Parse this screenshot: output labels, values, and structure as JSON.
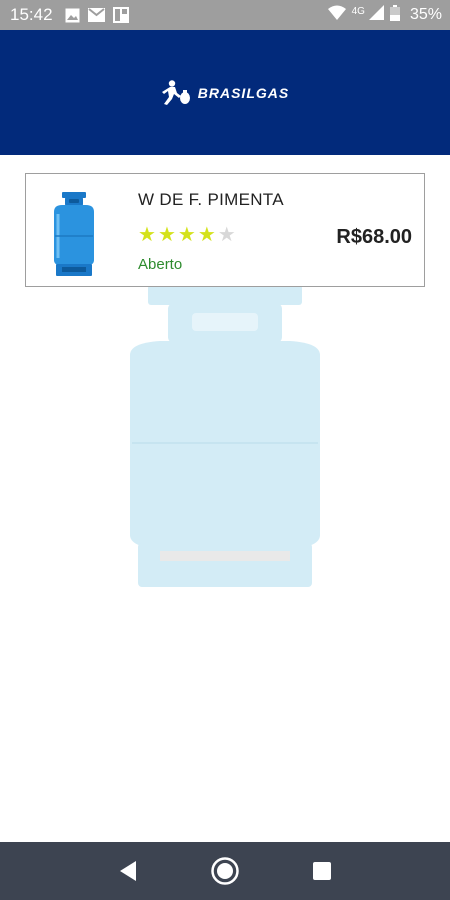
{
  "status_bar": {
    "time": "15:42",
    "network_type": "4G",
    "battery_percent": "35%",
    "icons": [
      "image-icon",
      "mail-icon",
      "grid-app-icon",
      "wifi-icon",
      "cell-signal-icon",
      "battery-icon"
    ]
  },
  "header": {
    "brand": "BRASILGAS",
    "background_color": "#022a7b"
  },
  "store": {
    "name": "W DE F. PIMENTA",
    "rating": 4,
    "max_rating": 5,
    "status": "Aberto",
    "price": "R$68.00",
    "status_color": "#2e8b2e"
  },
  "nav": {
    "buttons": [
      "back-icon",
      "home-icon",
      "recents-icon"
    ]
  }
}
